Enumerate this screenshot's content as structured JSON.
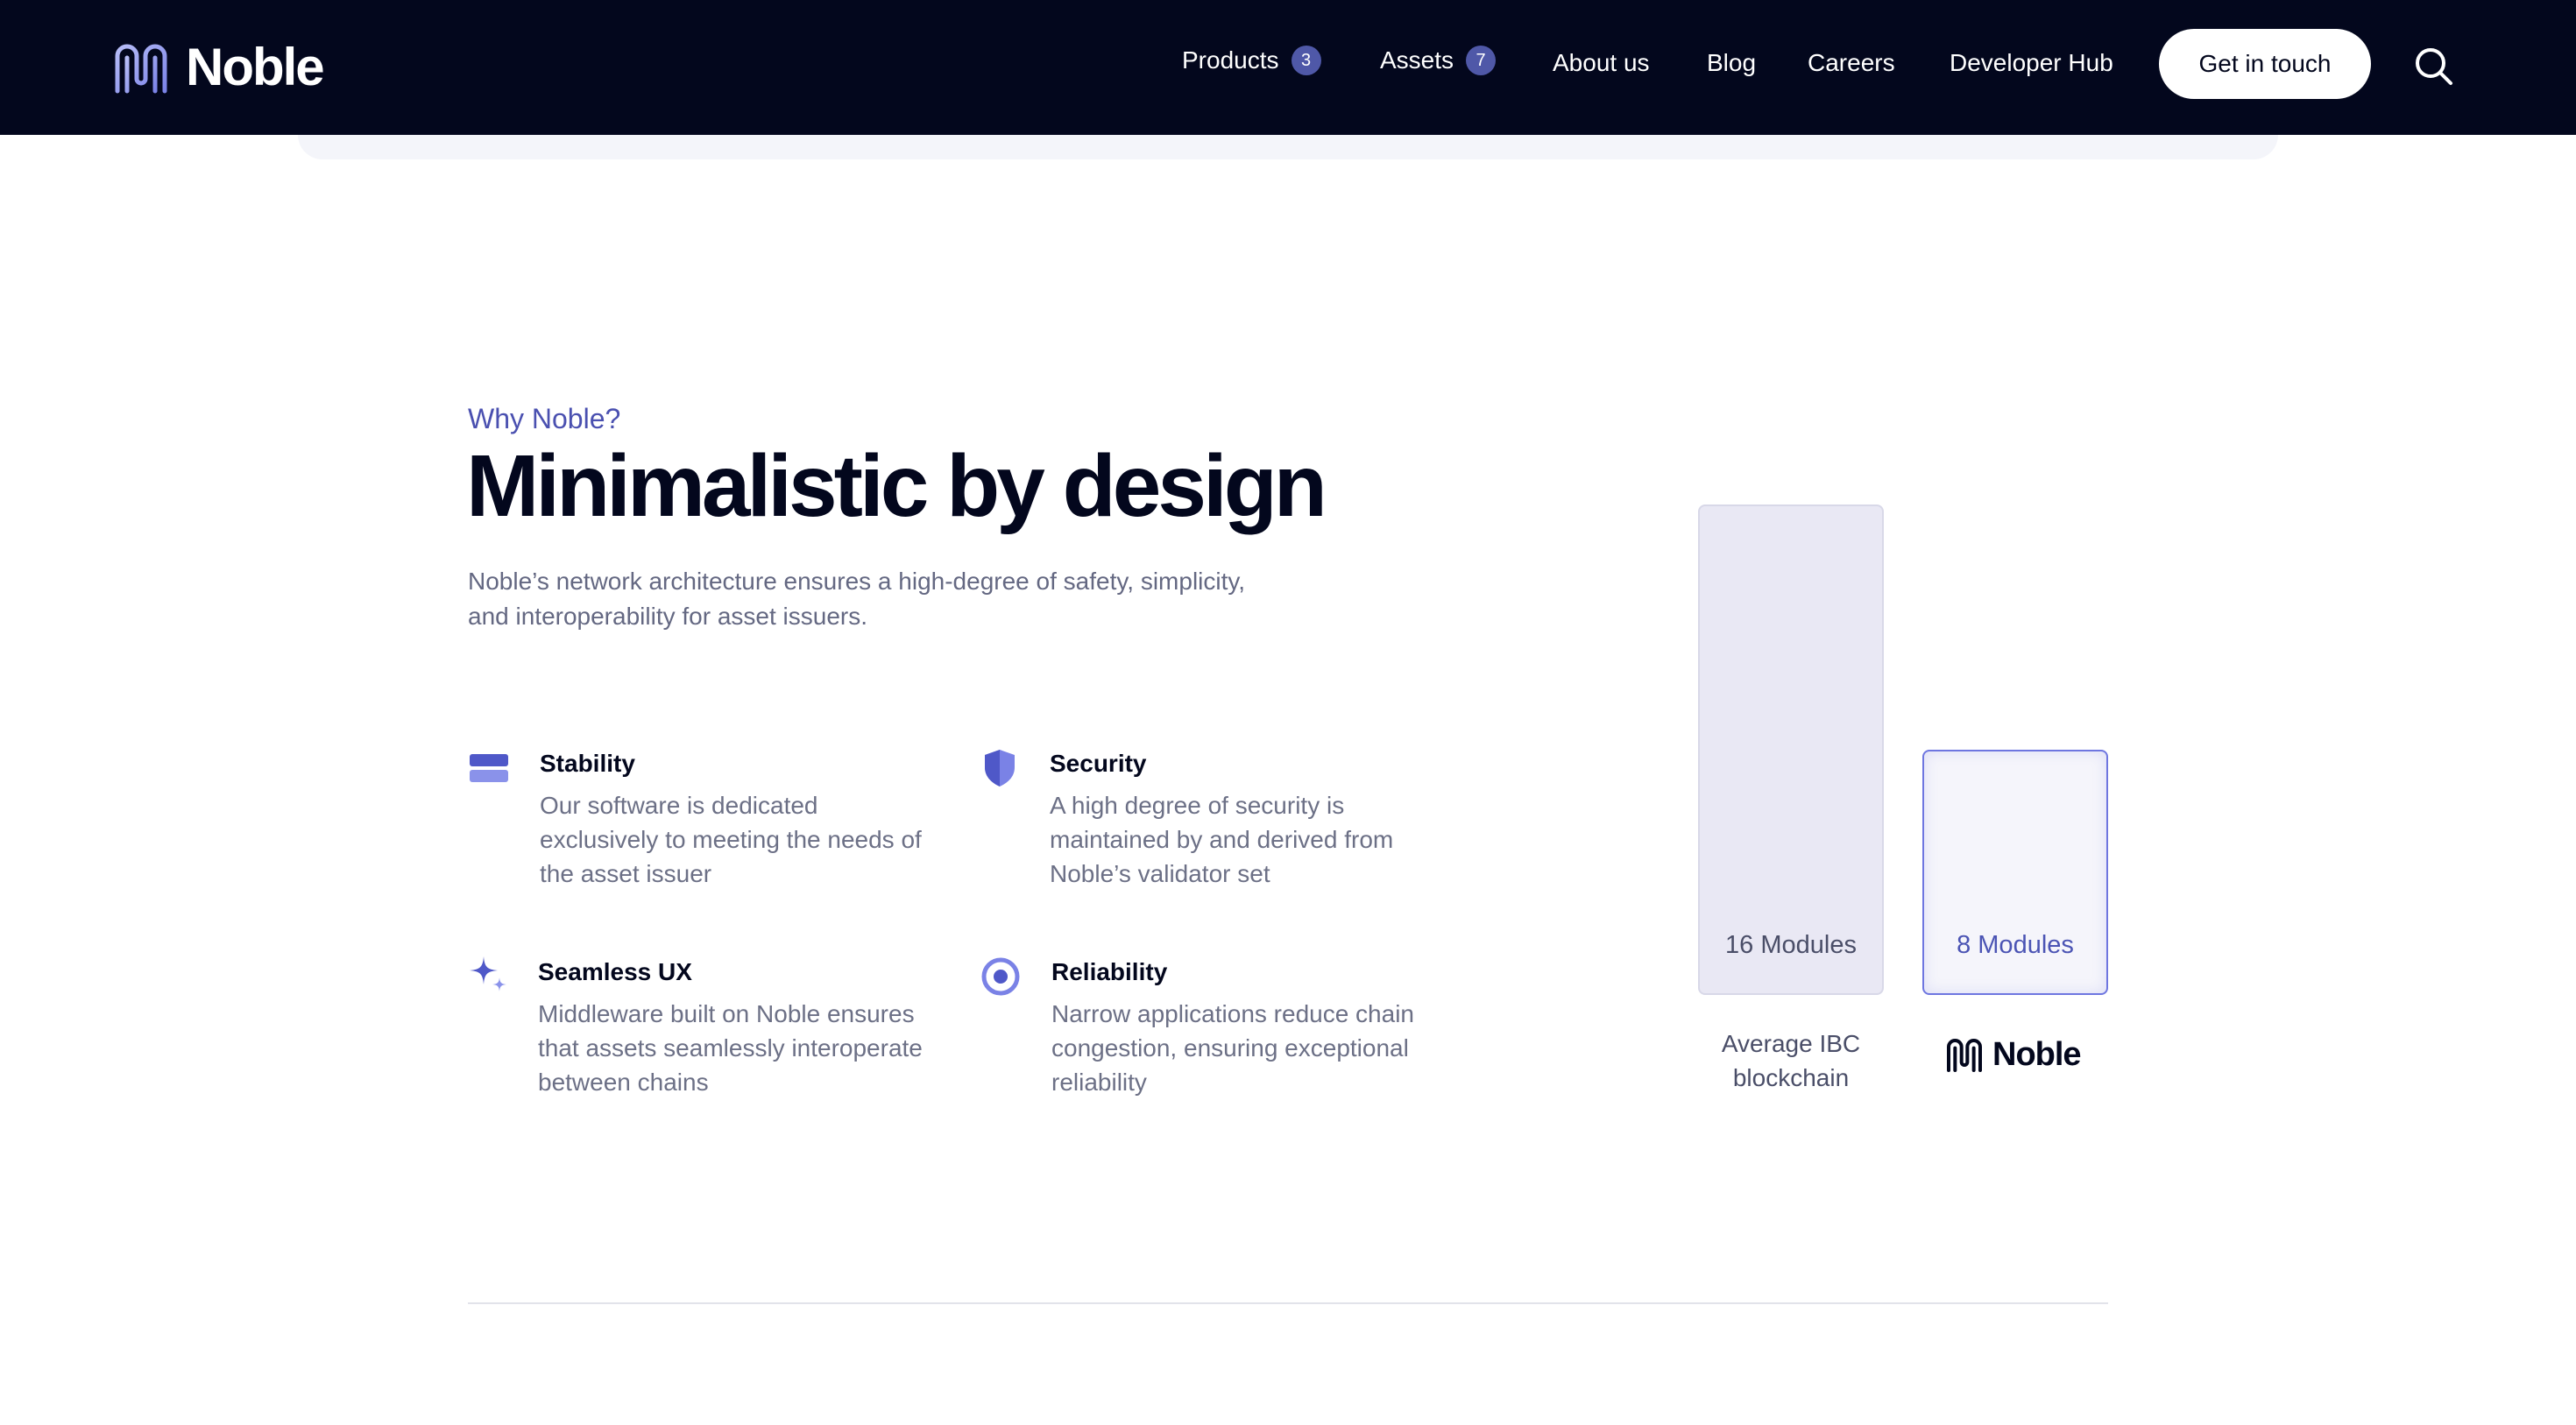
{
  "header": {
    "brand": "Noble",
    "nav": [
      {
        "label": "Products",
        "badge": "3"
      },
      {
        "label": "Assets",
        "badge": "7"
      },
      {
        "label": "About us"
      },
      {
        "label": "Blog"
      },
      {
        "label": "Careers"
      },
      {
        "label": "Developer Hub"
      }
    ],
    "cta_label": "Get in touch",
    "search_icon": "search-icon"
  },
  "section": {
    "eyebrow": "Why Noble?",
    "headline": "Minimalistic by design",
    "intro": "Noble’s network architecture ensures a high-degree of safety, simplicity, and interoperability for asset issuers."
  },
  "features": [
    {
      "icon": "stack-icon",
      "title": "Stability",
      "desc": "Our software is dedicated exclusively to meeting the needs of the asset issuer"
    },
    {
      "icon": "shield-icon",
      "title": "Security",
      "desc": "A high degree of security is maintained by and derived from Noble’s validator set"
    },
    {
      "icon": "sparkle-icon",
      "title": "Seamless UX",
      "desc": "Middleware built on Noble ensures that assets seamlessly interoperate between chains"
    },
    {
      "icon": "target-icon",
      "title": "Reliability",
      "desc": "Narrow applications reduce chain congestion, ensuring exceptional reliability"
    }
  ],
  "chart_data": {
    "type": "bar",
    "categories": [
      "Average IBC blockchain",
      "Noble"
    ],
    "values": [
      16,
      8
    ],
    "value_labels": [
      "16 Modules",
      "8 Modules"
    ],
    "title": "",
    "xlabel": "",
    "ylabel": "",
    "ylim": [
      0,
      16
    ],
    "colors": [
      "#e9e8f4",
      "#f5f5fb"
    ],
    "accent": "#6e76e0"
  },
  "colors": {
    "header_bg": "#03071d",
    "accent": "#4a50b0",
    "badge": "#4f58a8"
  }
}
